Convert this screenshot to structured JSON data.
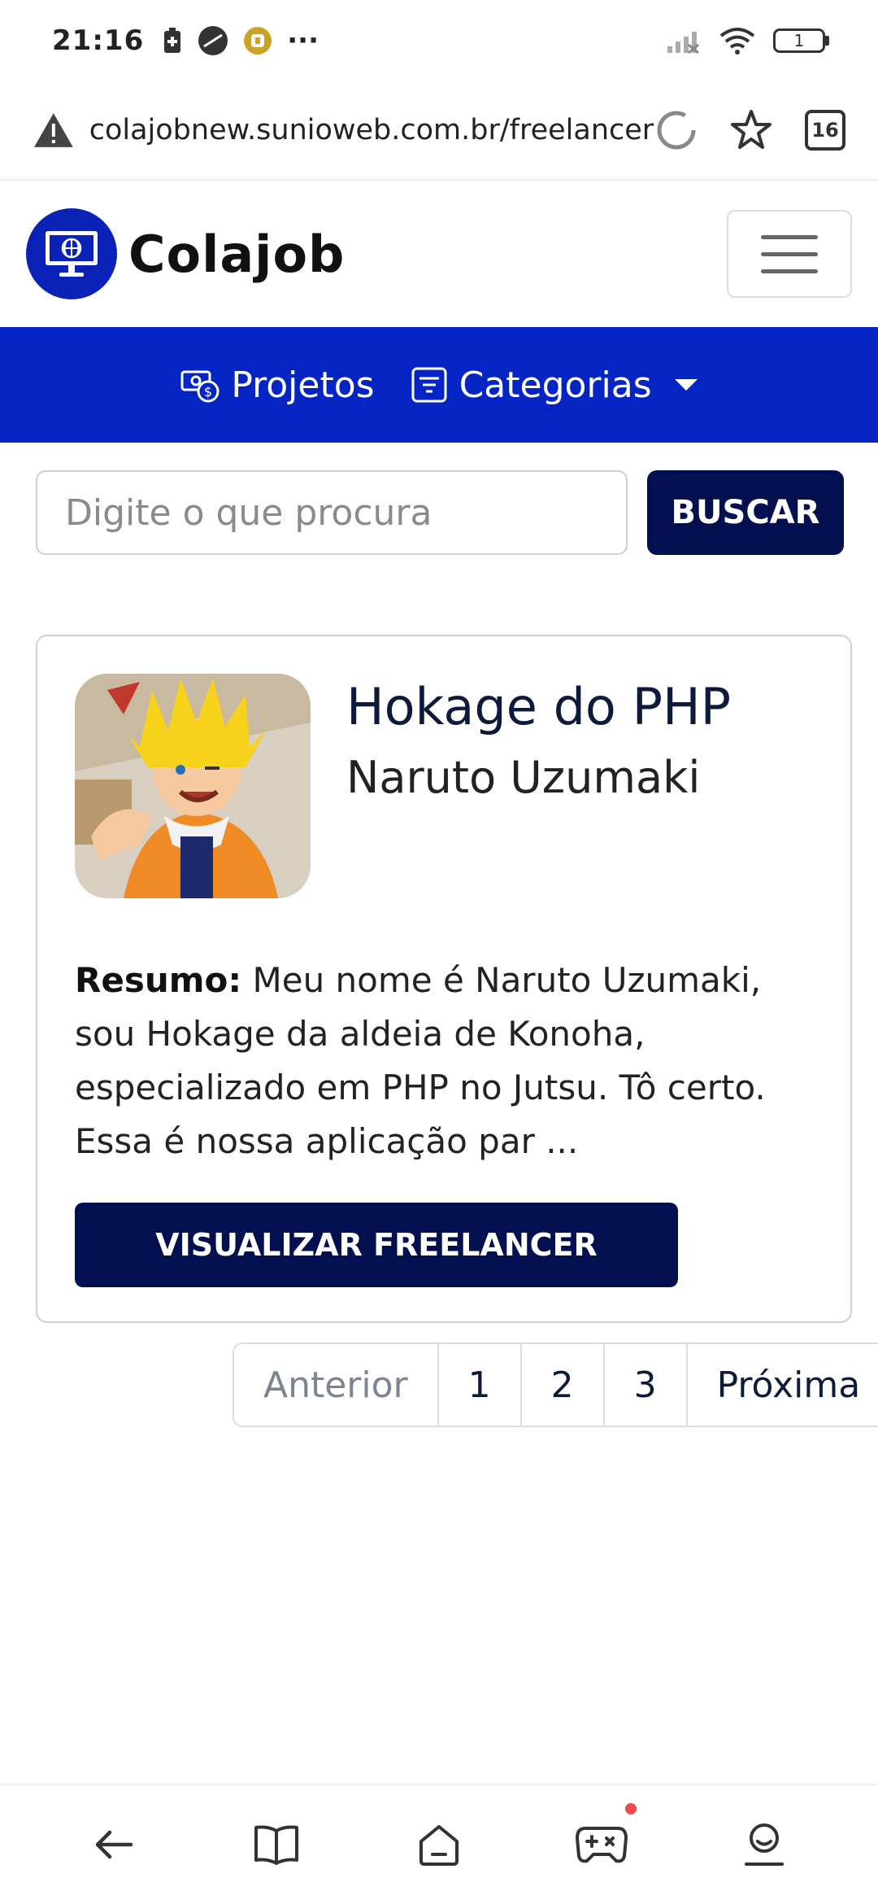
{
  "status_bar": {
    "time": "21:16",
    "more": "···",
    "battery": "1"
  },
  "browser": {
    "url": "colajobnew.sunioweb.com.br/freelancer",
    "tab_count": "16"
  },
  "site": {
    "brand": "Colajob",
    "nav": {
      "projects": "Projetos",
      "categories": "Categorias"
    },
    "search": {
      "placeholder": "Digite o que procura",
      "button": "BUSCAR"
    }
  },
  "card": {
    "title": "Hokage do PHP",
    "name": "Naruto Uzumaki",
    "summary_label": "Resumo:",
    "summary_text": " Meu nome é Naruto Uzumaki, sou Hokage da aldeia de Konoha, especializado em PHP no Jutsu. Tô certo. Essa é nossa aplicação par ...",
    "button": "VISUALIZAR FREELANCER"
  },
  "pagination": {
    "prev": "Anterior",
    "pages": [
      "1",
      "2",
      "3"
    ],
    "next": "Próxima"
  },
  "colors": {
    "brand_blue": "#0424c4",
    "dark_navy": "#03104f"
  }
}
